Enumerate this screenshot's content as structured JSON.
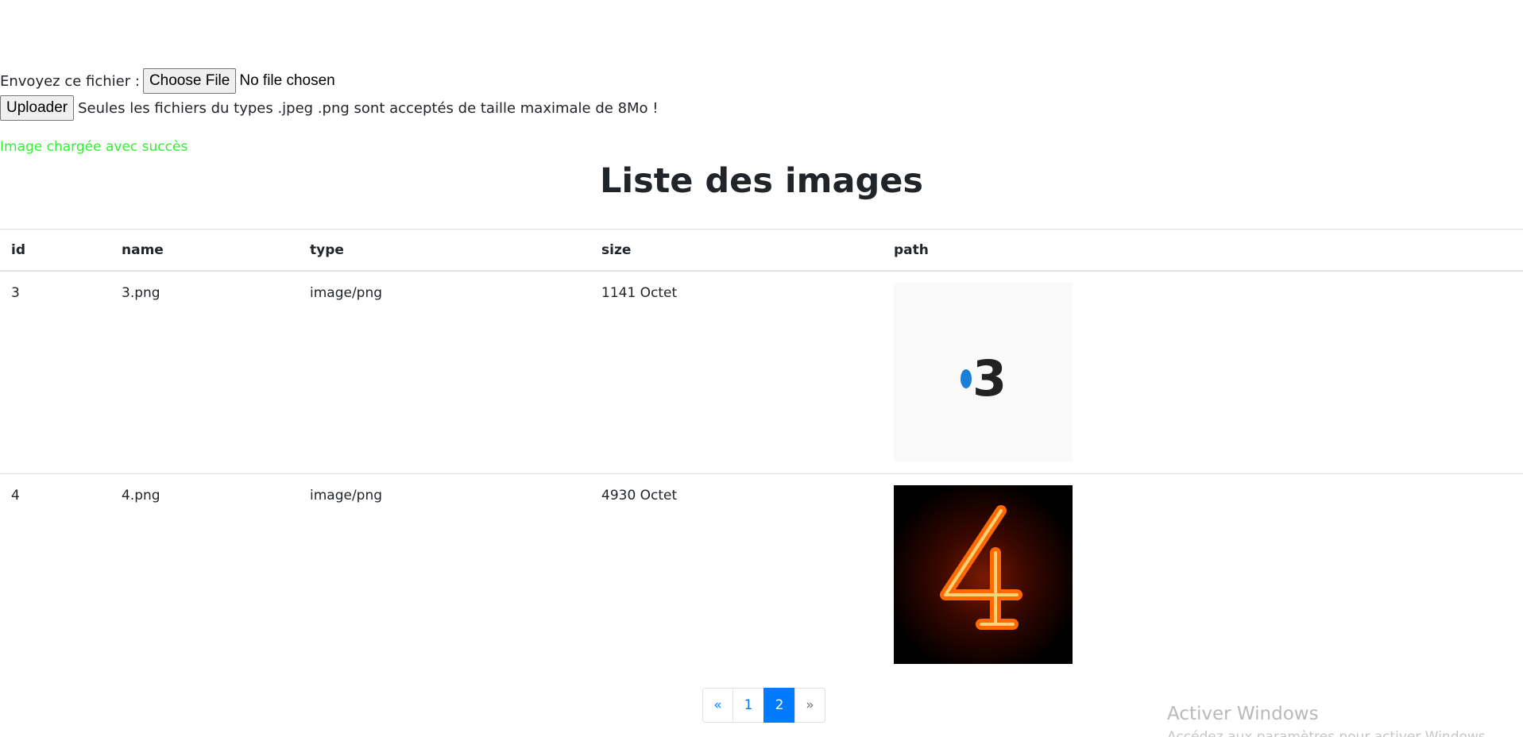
{
  "upload": {
    "send_label": "Envoyez ce fichier :",
    "choose_file_label": "Choose File",
    "no_file_text": "No file chosen",
    "upload_button_label": "Uploader",
    "note": "Seules les fichiers du types .jpeg .png sont acceptés de taille maximale de 8Mo !"
  },
  "status": {
    "success_message": "Image chargée avec succès",
    "success_color": "#33ee33"
  },
  "title": "Liste des images",
  "table": {
    "columns": [
      "id",
      "name",
      "type",
      "size",
      "path"
    ],
    "rows": [
      {
        "id": "3",
        "name": "3.png",
        "type": "image/png",
        "size": "1141 Octet",
        "thumb": "france3-logo"
      },
      {
        "id": "4",
        "name": "4.png",
        "type": "image/png",
        "size": "4930 Octet",
        "thumb": "fire-number-four"
      }
    ]
  },
  "pagination": {
    "prev": "«",
    "pages": [
      "1",
      "2"
    ],
    "active": "2",
    "next": "»",
    "accent_color": "#007bff"
  },
  "watermark": {
    "title": "Activer Windows",
    "subtitle": "Accédez aux paramètres pour activer Windows."
  }
}
